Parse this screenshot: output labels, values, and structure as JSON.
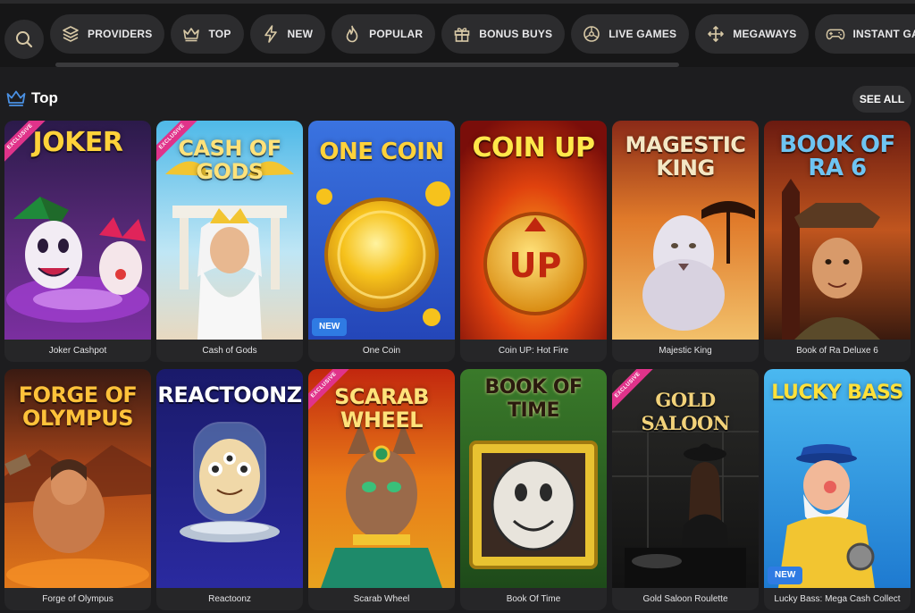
{
  "nav": {
    "search_icon": "search-icon",
    "pills": [
      {
        "label": "PROVIDERS",
        "icon": "layers-icon"
      },
      {
        "label": "TOP",
        "icon": "crown-icon"
      },
      {
        "label": "NEW",
        "icon": "lightning-icon"
      },
      {
        "label": "POPULAR",
        "icon": "flame-icon"
      },
      {
        "label": "BONUS BUYS",
        "icon": "gift-icon"
      },
      {
        "label": "LIVE GAMES",
        "icon": "roulette-icon"
      },
      {
        "label": "MEGAWAYS",
        "icon": "arrows-icon"
      },
      {
        "label": "INSTANT GAMES",
        "icon": "gamepad-icon"
      }
    ]
  },
  "section": {
    "title": "Top",
    "see_all": "SEE ALL"
  },
  "badges": {
    "exclusive": "EXCLUSIVE",
    "new": "NEW"
  },
  "games": [
    {
      "title": "Joker Cashpot",
      "logo": "JOKER",
      "exclusive": true,
      "new": false
    },
    {
      "title": "Cash of Gods",
      "logo": "CASH OF GODS",
      "exclusive": true,
      "new": false
    },
    {
      "title": "One Coin",
      "logo": "ONE COIN",
      "exclusive": false,
      "new": true
    },
    {
      "title": "Coin UP: Hot Fire",
      "logo": "COIN UP",
      "exclusive": false,
      "new": false
    },
    {
      "title": "Majestic King",
      "logo": "MAGESTIC KING",
      "exclusive": false,
      "new": false
    },
    {
      "title": "Book of Ra Deluxe 6",
      "logo": "BOOK OF RA 6",
      "exclusive": false,
      "new": false
    },
    {
      "title": "Forge of Olympus",
      "logo": "FORGE OF OLYMPUS",
      "exclusive": false,
      "new": false
    },
    {
      "title": "Reactoonz",
      "logo": "REACTOONZ",
      "exclusive": false,
      "new": false
    },
    {
      "title": "Scarab Wheel",
      "logo": "SCARAB WHEEL",
      "exclusive": true,
      "new": false
    },
    {
      "title": "Book Of Time",
      "logo": "BOOK OF TIME",
      "exclusive": false,
      "new": false
    },
    {
      "title": "Gold Saloon Roulette",
      "logo": "GOLD SALOON",
      "exclusive": true,
      "new": false
    },
    {
      "title": "Lucky Bass: Mega Cash Collect",
      "logo": "LUCKY BASS",
      "exclusive": false,
      "new": true
    }
  ],
  "colors": {
    "page_bg": "#1d1d1f",
    "pill_bg": "#2c2c2e",
    "accent_icon": "#d8c9a6",
    "exclusive_ribbon": "#e0338a",
    "new_badge": "#2f7be3"
  }
}
